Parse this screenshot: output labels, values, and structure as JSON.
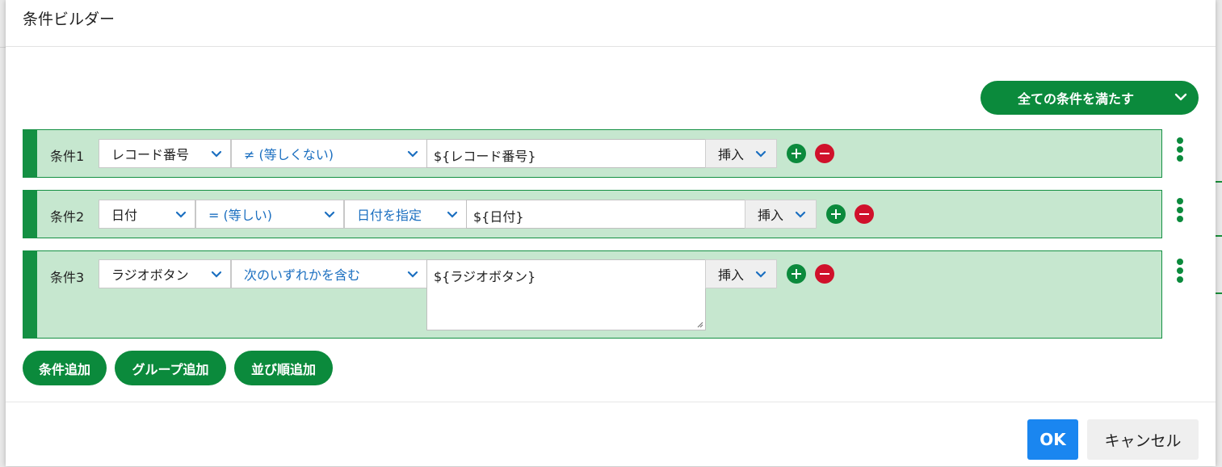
{
  "dialog": {
    "title": "条件ビルダー",
    "match_mode": "全ての条件を満たす"
  },
  "conditions": [
    {
      "label": "条件1",
      "field": "レコード番号",
      "operator": "≠ (等しくない)",
      "value": "${レコード番号}",
      "insert": "挿入"
    },
    {
      "label": "条件2",
      "field": "日付",
      "operator": "= (等しい)",
      "date_mode": "日付を指定",
      "value": "${日付}",
      "insert": "挿入"
    },
    {
      "label": "条件3",
      "field": "ラジオボタン",
      "operator": "次のいずれかを含む",
      "value": "${ラジオボタン}",
      "insert": "挿入"
    }
  ],
  "actions": {
    "add_condition": "条件追加",
    "add_group": "グループ追加",
    "add_sort": "並び順追加"
  },
  "footer": {
    "ok": "OK",
    "cancel": "キャンセル"
  },
  "colors": {
    "accent_green": "#0b8a3c",
    "row_bg": "#c6e7cf",
    "remove_red": "#d0112b",
    "ok_blue": "#1a86f0",
    "link_blue": "#1b6fc0"
  },
  "icons": {
    "dropdown": "chevron-down-icon",
    "add": "plus-circle-icon",
    "remove": "minus-circle-icon",
    "menu": "kebab-menu-icon"
  }
}
